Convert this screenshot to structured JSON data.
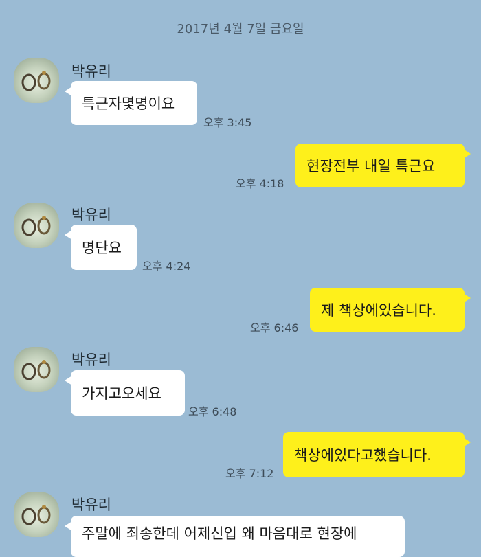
{
  "date_divider": "2017년 4월 7일 금요일",
  "messages": [
    {
      "sender": "박유리",
      "text": "특근자몇명이요",
      "time": "오후 3:45"
    },
    {
      "text": "현장전부 내일 특근요",
      "time": "오후 4:18"
    },
    {
      "sender": "박유리",
      "text": "명단요",
      "time": "오후 4:24"
    },
    {
      "text": "제 책상에있습니다.",
      "time": "오후 6:46"
    },
    {
      "sender": "박유리",
      "text": "가지고오세요",
      "time": "오후 6:48"
    },
    {
      "text": "책상에있다고했습니다.",
      "time": "오후 7:12"
    },
    {
      "sender": "박유리",
      "text": "주말에 죄송한데 어제신입 왜 마음대로 현장에"
    }
  ],
  "colors": {
    "background": "#9bbbd4",
    "incoming_bubble": "#ffffff",
    "outgoing_bubble": "#fef01b"
  },
  "icons": {
    "avatar": "profile-photo-avatar"
  }
}
